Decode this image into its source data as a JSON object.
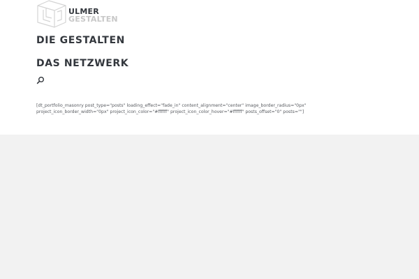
{
  "header": {
    "logo": {
      "line1": "ULMER",
      "line2": "GESTALTEN",
      "icon": "cube-logo-icon"
    },
    "menu": {
      "items": [
        {
          "label": "DIE GESTALTEN"
        },
        {
          "label": "DAS NETZWERK"
        }
      ]
    },
    "search": {
      "icon": "search-icon"
    }
  },
  "content": {
    "shortcode": "[dt_portfolio_masonry post_type=\"posts\" loading_effect=\"fade_in\" content_alignment=\"center\" image_border_radius=\"0px\" project_icon_border_width=\"0px\" project_icon_color=\"#ffffff\" project_icon_color_hover=\"#ffffff\" posts_offset=\"0\" posts=\"\"]"
  },
  "colors": {
    "text_dark": "#33373d",
    "logo_light": "#c8c8c8",
    "body_text": "#585b60",
    "top_background": "#ffffff",
    "bottom_background": "#f2f2f2"
  }
}
